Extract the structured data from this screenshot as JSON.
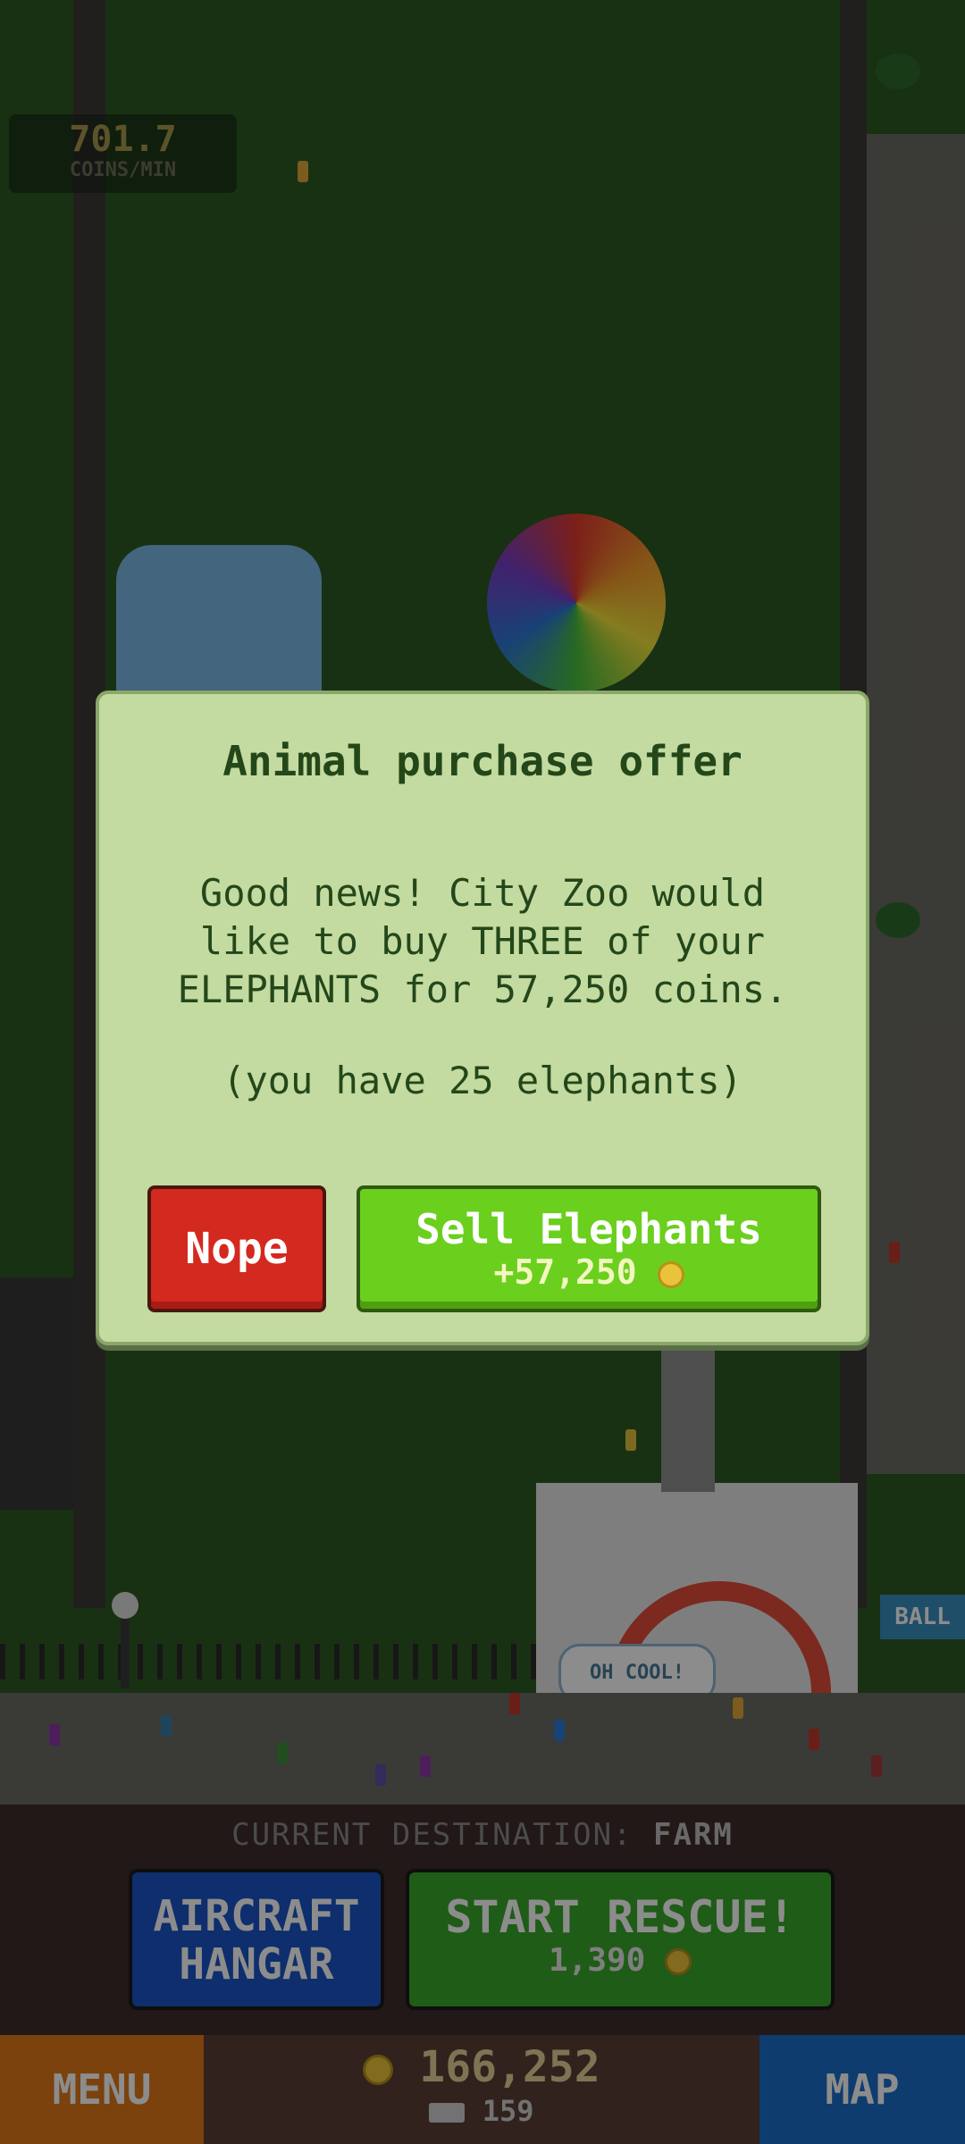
{
  "rate": {
    "value": "701.7",
    "unit": "COINS/MIN"
  },
  "world": {
    "sign_oh_cool": "OH COOL!",
    "sign_ball": "BALL"
  },
  "dialog": {
    "title": "Animal purchase offer",
    "message_line1": "Good news! City Zoo would",
    "message_line2": "like to buy THREE of your",
    "message_line3": "ELEPHANTS for 57,250 coins.",
    "count": "(you have 25 elephants)",
    "nope_label": "Nope",
    "sell_label": "Sell Elephants",
    "sell_reward": "+57,250"
  },
  "hud": {
    "destination_label": "CURRENT DESTINATION:",
    "destination_value": "FARM",
    "hangar_line1": "AIRCRAFT",
    "hangar_line2": "HANGAR",
    "rescue_label": "START RESCUE!",
    "rescue_cost": "1,390",
    "menu_label": "MENU",
    "map_label": "MAP",
    "coins": "166,252",
    "passengers": "159"
  },
  "icons": [
    "coin-icon",
    "passenger-icon",
    "hot-air-balloon",
    "tree-icon"
  ],
  "colors": {
    "dialog_bg": "#c3dba0",
    "nope": "#d4291e",
    "sell": "#6bcf1e",
    "hangar": "#1b55c6",
    "rescue": "#39a82b",
    "menu": "#e07918",
    "map": "#1b6ec9"
  }
}
